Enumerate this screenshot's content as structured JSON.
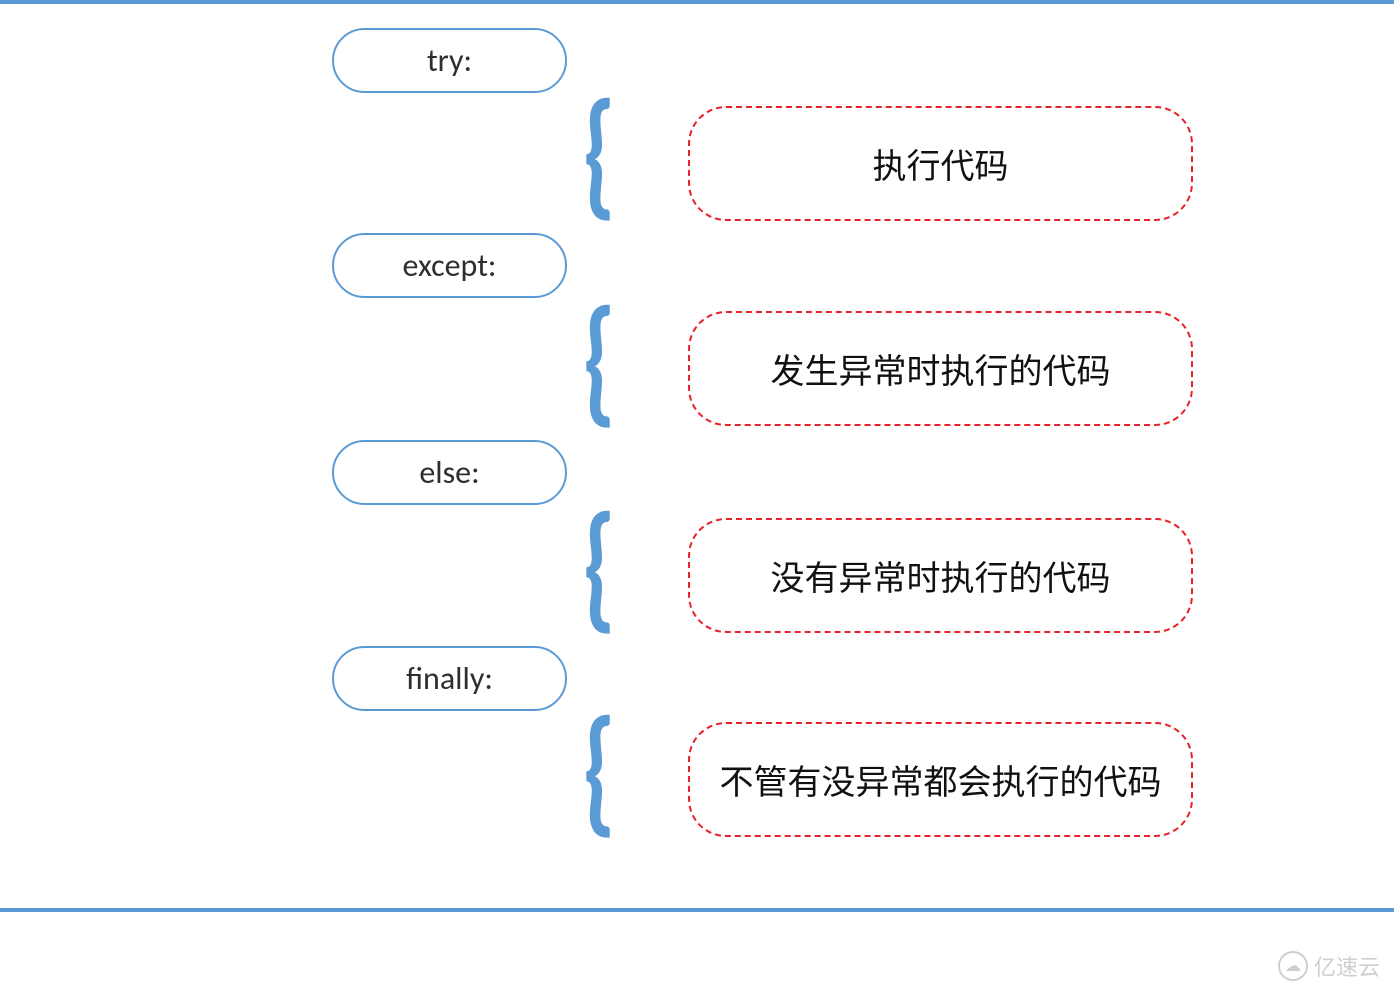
{
  "blocks": [
    {
      "keyword": "try:",
      "description": "执行代码"
    },
    {
      "keyword": "except:",
      "description": "发生异常时执行的代码"
    },
    {
      "keyword": "else:",
      "description": "没有异常时执行的代码"
    },
    {
      "keyword": "finally:",
      "description": "不管有没异常都会执行的代码"
    }
  ],
  "watermark": "亿速云",
  "watermark_icon": "ⓘ"
}
